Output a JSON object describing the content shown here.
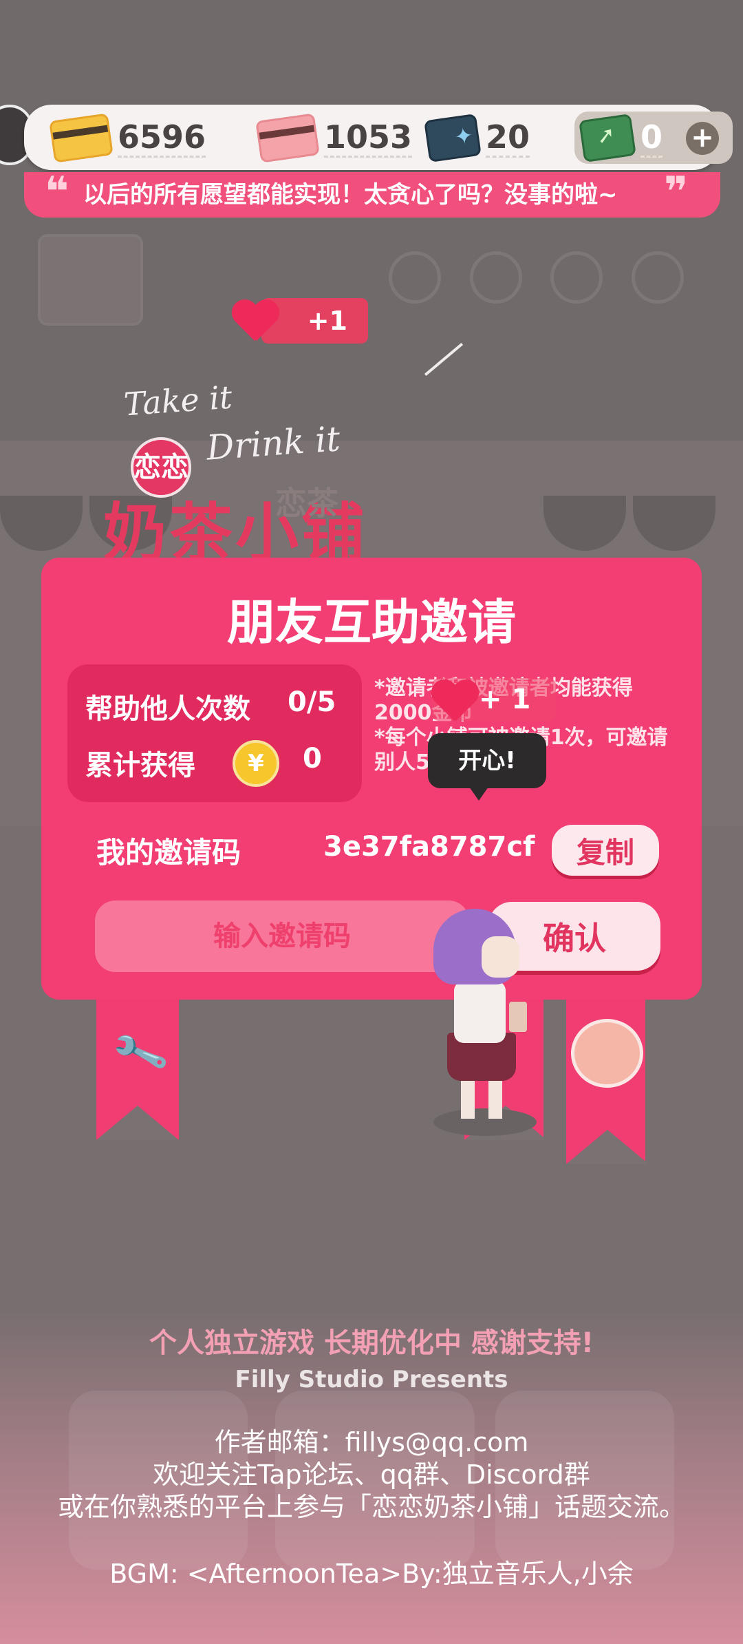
{
  "currencies": [
    {
      "name": "gold-card",
      "value": "6596",
      "color": "#f6c443"
    },
    {
      "name": "heart-card",
      "value": "1053",
      "color": "#f4a3a8"
    },
    {
      "name": "sparkle-ticket",
      "value": "20",
      "color": "#2e4a5c"
    },
    {
      "name": "exchange-ticket",
      "value": "0",
      "color": "#3f8d52"
    }
  ],
  "marquee": {
    "text": "以后的所有愿望都能实现！太贪心了吗？没事的啦~"
  },
  "heart_bonus": {
    "text": "+1"
  },
  "logo": {
    "line1": "Take it",
    "line2": "Drink it",
    "badge": "恋恋",
    "main": "奶茶小铺",
    "shadow": "恋茶"
  },
  "dialog": {
    "title": "朋友互助邀请",
    "help_label": "帮助他人次数",
    "help_value": "0/5",
    "earned_label": "累计获得",
    "coin_symbol": "¥",
    "earned_value": "0",
    "note1": "*邀请者和被邀请者均能获得2000金币",
    "note2": "*每个小铺可被邀请1次，可邀请别人5次",
    "code_label": "我的邀请码",
    "code_value": "3e37fa8787cf",
    "copy_label": "复制",
    "input_placeholder": "输入邀请码",
    "confirm_label": "确认"
  },
  "float_heart": {
    "text": "+ 1"
  },
  "speech": {
    "text": "开心!"
  },
  "footer": {
    "tagline": "个人独立游戏 长期优化中 感谢支持!",
    "studio": "Filly Studio Presents",
    "email": "作者邮箱：fillys@qq.com",
    "follow": "欢迎关注Tap论坛、qq群、Discord群",
    "join": "或在你熟悉的平台上参与「恋恋奶茶小铺」话题交流。",
    "bgm": "BGM: <AfternoonTea>By:独立音乐人,小余"
  },
  "colors": {
    "accent": "#f33e73",
    "button_text": "#e1345f"
  }
}
